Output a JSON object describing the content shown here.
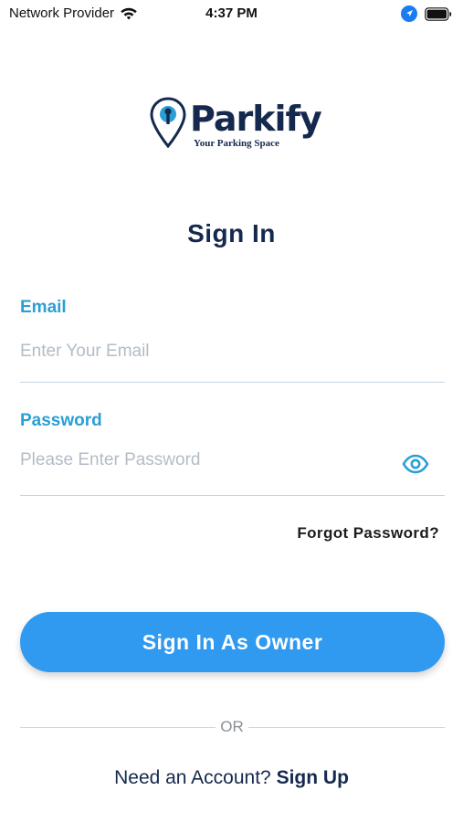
{
  "status_bar": {
    "carrier": "Network Provider",
    "time": "4:37 PM",
    "icons": [
      "wifi-icon",
      "location-arrow-icon",
      "battery-icon"
    ]
  },
  "logo": {
    "name": "Parkify",
    "tagline": "Your Parking Space"
  },
  "title": "Sign In",
  "email": {
    "label": "Email",
    "placeholder": "Enter Your Email",
    "value": ""
  },
  "password": {
    "label": "Password",
    "placeholder": "Please Enter Password",
    "value": "",
    "toggle_icon": "eye-icon"
  },
  "forgot_password": "Forgot Password?",
  "primary_button": "Sign In As Owner",
  "divider_text": "OR",
  "footer": {
    "prompt": "Need an Account?",
    "link": "Sign Up"
  },
  "colors": {
    "brand_navy": "#15294f",
    "label_blue": "#2a9fd6",
    "button_blue": "#2f9af0",
    "placeholder_gray": "#b4bcc5"
  }
}
